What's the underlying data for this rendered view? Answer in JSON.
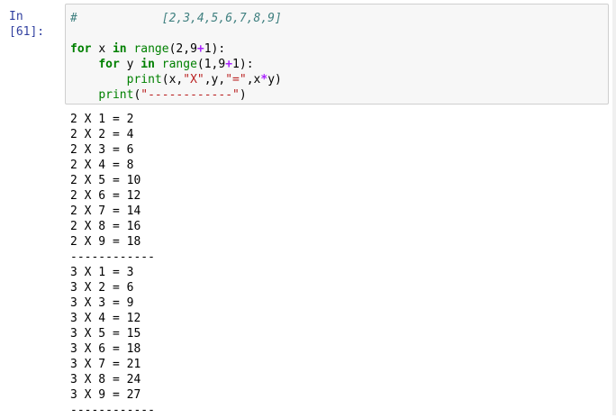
{
  "prompt": "In [61]:",
  "code": {
    "line1": {
      "hash": "#",
      "comment": "[2,3,4,5,6,7,8,9]"
    },
    "line3": {
      "kw_for": "for",
      "var": "x",
      "kw_in": "in",
      "fn": "range",
      "args1": "(2,9",
      "plus": "+",
      "args2": "1):"
    },
    "line4": {
      "kw_for": "for",
      "var": "y",
      "kw_in": "in",
      "fn": "range",
      "args1": "(1,9",
      "plus": "+",
      "args2": "1):"
    },
    "line5": {
      "fn": "print",
      "p1": "(x,",
      "s1": "\"X\"",
      "p2": ",y,",
      "s2": "\"=\"",
      "p3": ",x",
      "star": "*",
      "p4": "y)"
    },
    "line6": {
      "fn": "print",
      "p1": "(",
      "s1": "\"------------\"",
      "p2": ")"
    }
  },
  "output_lines": [
    "2 X 1 = 2",
    "2 X 2 = 4",
    "2 X 3 = 6",
    "2 X 4 = 8",
    "2 X 5 = 10",
    "2 X 6 = 12",
    "2 X 7 = 14",
    "2 X 8 = 16",
    "2 X 9 = 18",
    "------------",
    "3 X 1 = 3",
    "3 X 2 = 6",
    "3 X 3 = 9",
    "3 X 4 = 12",
    "3 X 5 = 15",
    "3 X 6 = 18",
    "3 X 7 = 21",
    "3 X 8 = 24",
    "3 X 9 = 27",
    "------------"
  ],
  "colors": {
    "prompt": "#303f9f",
    "keyword": "#008000",
    "operator": "#aa22ff",
    "string": "#ba2121",
    "comment": "#408080",
    "cell_bg": "#f7f7f7"
  }
}
